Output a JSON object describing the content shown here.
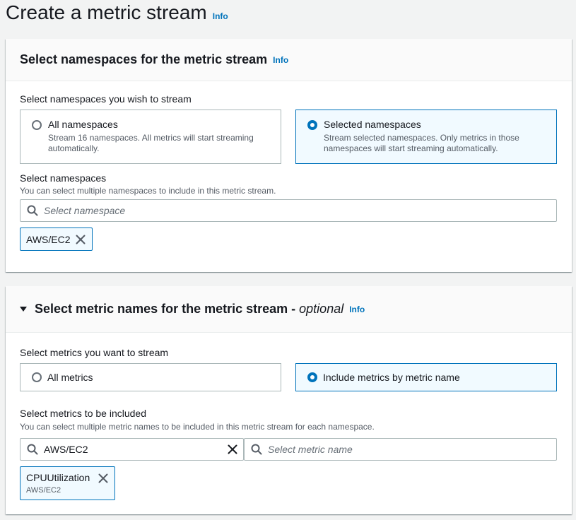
{
  "page": {
    "title": "Create a metric stream",
    "info": "Info"
  },
  "namespaces_card": {
    "title": "Select namespaces for the metric stream",
    "info": "Info",
    "prompt": "Select namespaces you wish to stream",
    "options": [
      {
        "title": "All namespaces",
        "desc_line1": "Stream 16 namespaces. All metrics will start streaming",
        "desc_line2": "automatically.",
        "selected": false
      },
      {
        "title": "Selected namespaces",
        "desc_line1": "Stream selected namespaces. Only metrics in those",
        "desc_line2": "namespaces will start streaming automatically.",
        "selected": true
      }
    ],
    "select_label": "Select namespaces",
    "select_desc": "You can select multiple namespaces to include in this metric stream.",
    "search_placeholder": "Select namespace",
    "tokens": [
      {
        "label": "AWS/EC2"
      }
    ]
  },
  "metrics_card": {
    "title": "Select metric names for the metric stream - ",
    "optional": "optional",
    "info": "Info",
    "prompt": "Select metrics you want to stream",
    "options": [
      {
        "title": "All metrics",
        "selected": false
      },
      {
        "title": "Include metrics by metric name",
        "selected": true
      }
    ],
    "select_label": "Select metrics to be included",
    "select_desc": "You can select multiple metric names to be included in this metric stream for each namespace.",
    "namespace_value": "AWS/EC2",
    "metric_placeholder": "Select metric name",
    "tokens": [
      {
        "label": "CPUUtilization",
        "sub": "AWS/EC2"
      }
    ]
  },
  "colors": {
    "accent": "#0073bb",
    "selected_bg": "#f1faff",
    "background": "#f2f3f3"
  },
  "icons": {
    "search": "search-icon",
    "remove": "close-icon",
    "expand": "caret-down-icon",
    "radio": "radio-icon"
  }
}
